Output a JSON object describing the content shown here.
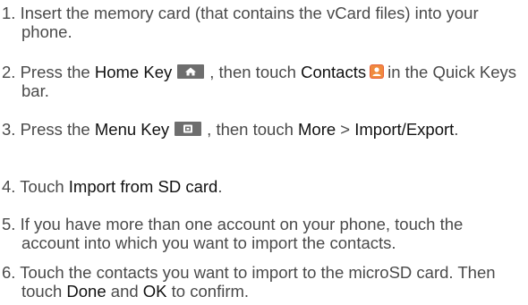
{
  "steps": [
    {
      "num": "1.",
      "text": "Insert the memory card (that contains the vCard files) into your phone."
    },
    {
      "num": "2.",
      "pre": "Press the",
      "key_label": "Home Key",
      "mid": ", then touch",
      "target": "Contacts",
      "post": "in the Quick Keys bar."
    },
    {
      "num": "3.",
      "pre": "Press the",
      "key_label": "Menu Key",
      "mid": ", then touch",
      "target1": "More",
      "sep": ">",
      "target2": "Import/Export",
      "post": "."
    },
    {
      "num": "4.",
      "pre": "Touch",
      "target": "Import from SD card",
      "post": "."
    },
    {
      "num": "5.",
      "text": "If you have more than one account on your phone, touch the account into which you want to import the contacts."
    },
    {
      "num": "6.",
      "pre": "Touch the contacts you want to import to the microSD card. Then touch",
      "target1": "Done",
      "mid": "and",
      "target2": "OK",
      "post": "to confirm."
    }
  ],
  "icons": {
    "home_key": "home-key-icon",
    "contacts": "contacts-icon",
    "menu_key": "menu-key-icon"
  }
}
